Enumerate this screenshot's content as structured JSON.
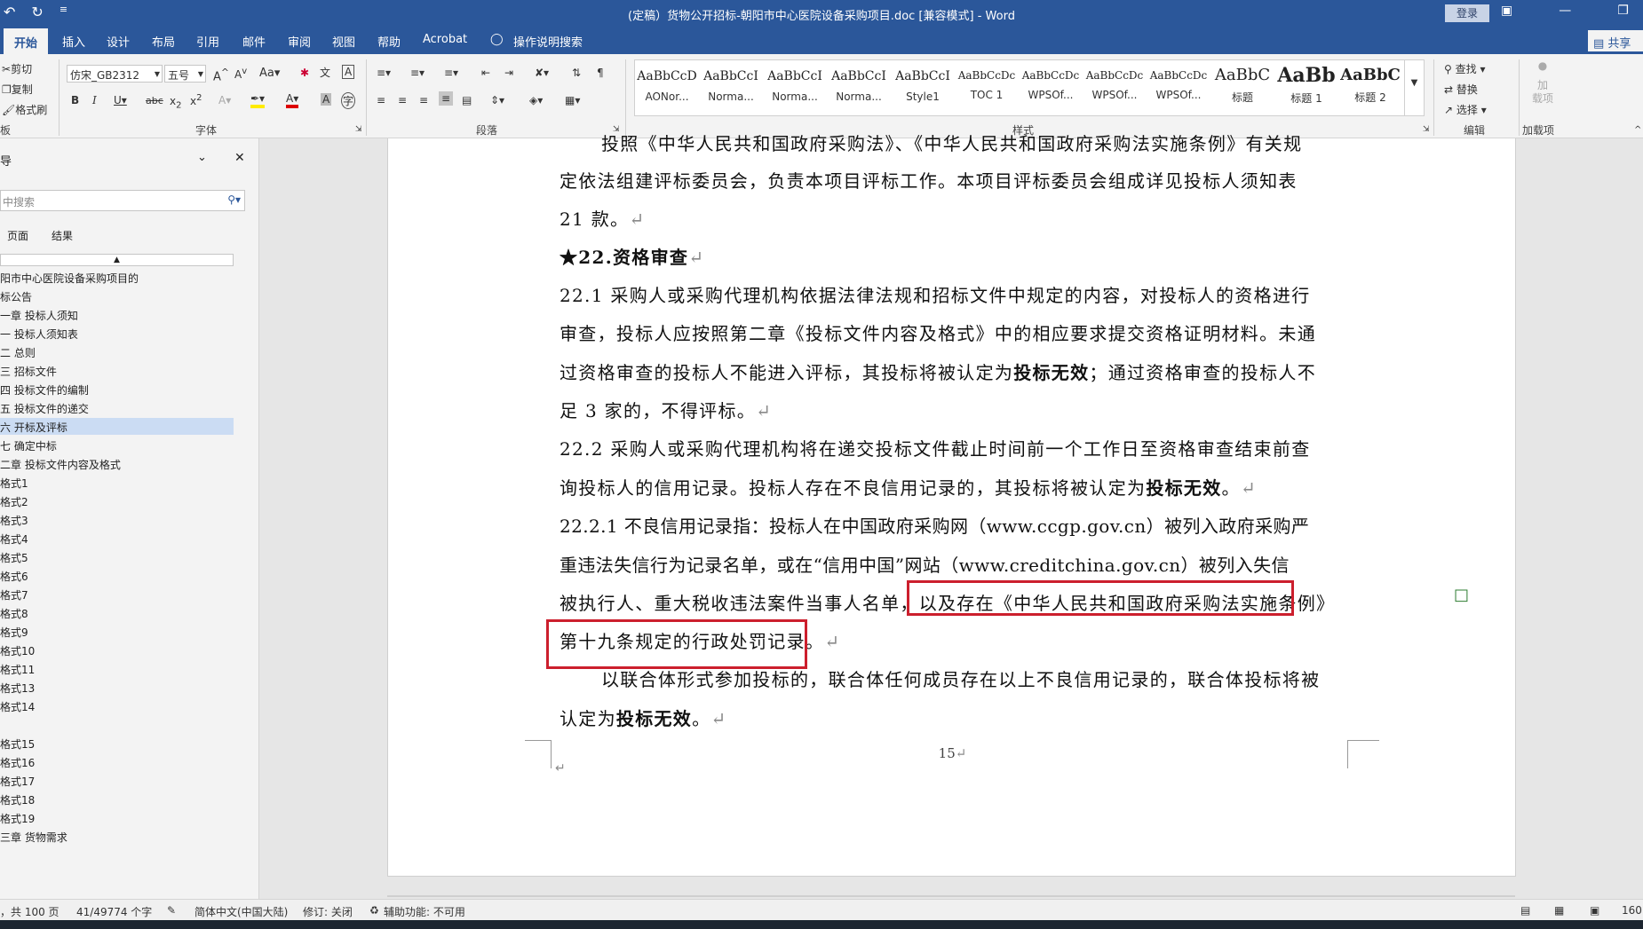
{
  "titlebar": {
    "title": "(定稿）货物公开招标-朝阳市中心医院设备采购项目.doc [兼容模式] - Word",
    "login": "登录",
    "undo_icon": "undo-icon",
    "redo_icon": "redo-icon"
  },
  "tabs": [
    "开始",
    "插入",
    "设计",
    "布局",
    "引用",
    "邮件",
    "审阅",
    "视图",
    "帮助",
    "Acrobat",
    "操作说明搜索"
  ],
  "share": "共享",
  "ribbon": {
    "clipboard": {
      "cut": "剪切",
      "copy": "复制",
      "format_painter": "格式刷",
      "label": "板"
    },
    "font": {
      "name": "仿宋_GB2312",
      "size": "五号",
      "label": "字体"
    },
    "paragraph": {
      "label": "段落"
    },
    "styles": {
      "label": "样式",
      "items": [
        {
          "preview": "AaBbCcD",
          "name": "AONor..."
        },
        {
          "preview": "AaBbCcI",
          "name": "Norma..."
        },
        {
          "preview": "AaBbCcI",
          "name": "Norma..."
        },
        {
          "preview": "AaBbCcI",
          "name": "Norma..."
        },
        {
          "preview": "AaBbCcI",
          "name": "Style1"
        },
        {
          "preview": "AaBbCcDc",
          "name": "TOC 1"
        },
        {
          "preview": "AaBbCcDc",
          "name": "WPSOf..."
        },
        {
          "preview": "AaBbCcDc",
          "name": "WPSOf..."
        },
        {
          "preview": "AaBbCcDc",
          "name": "WPSOf..."
        },
        {
          "preview": "AaBbC",
          "name": "标题"
        },
        {
          "preview": "AaBb",
          "name": "标题 1"
        },
        {
          "preview": "AaBbC",
          "name": "标题 2"
        }
      ]
    },
    "editing": {
      "find": "查找",
      "replace": "替换",
      "select": "选择",
      "label": "编辑"
    },
    "addins": {
      "btn": "加\n载项",
      "label": "加载项"
    }
  },
  "navpane": {
    "title": "导",
    "search_placeholder": "中搜索",
    "tabs": [
      "页面",
      "结果"
    ],
    "items": [
      "阳市中心医院设备采购项目的",
      "标公告",
      "一章 投标人须知",
      "一 投标人须知表",
      "二 总则",
      "三 招标文件",
      "四 投标文件的编制",
      "五 投标文件的递交",
      "六 开标及评标",
      "七 确定中标",
      "二章 投标文件内容及格式",
      "格式1",
      "格式2",
      "格式3",
      "格式4",
      "格式5",
      "格式6",
      "格式7",
      "格式8",
      "格式9",
      "格式10",
      "格式11",
      "格式13",
      "格式14",
      "",
      "格式15",
      "格式16",
      "格式17",
      "格式18",
      "格式19",
      "三章 货物需求"
    ],
    "selected_index": 8
  },
  "document": {
    "lines": [
      "投照《中华人民共和国政府采购法》、《中华人民共和国政府采购法实施条例》有关规",
      "定依法组建评标委员会，负责本项目评标工作。本项目评标委员会组成详见投标人须知表",
      "21 款。",
      "★22.资格审查",
      "22.1 采购人或采购代理机构依据法律法规和招标文件中规定的内容，对投标人的资格进行",
      "审查，投标人应按照第二章《投标文件内容及格式》中的相应要求提交资格证明材料。未通",
      "过资格审查的投标人不能进入评标，其投标将被认定为",
      "投标无效",
      "；通过资格审查的投标人不",
      "足 3 家的，不得评标。",
      "22.2 采购人或采购代理机构将在递交投标文件截止时间前一个工作日至资格审查结束前查",
      "询投标人的信用记录。投标人存在不良信用记录的，其投标将被认定为",
      "投标无效",
      "。",
      "22.2.1 不良信用记录指：投标人在中国政府采购网（www.ccgp.gov.cn）被列入政府采购严",
      "重违法失信行为记录名单，或在“信用中国”网站（www.creditchina.gov.cn）被列入失信",
      "被执行人、重大税收违法案件当事人名单，以及存在《中华人民共和国政府采购法实施条例》",
      "第十九条规定的行政处罚记录。",
      "以联合体形式参加投标的，联合体任何成员存在以上不良信用记录的，联合体投标将被",
      "认定为",
      "投标无效",
      "。"
    ],
    "page_number": "15"
  },
  "statusbar": {
    "pages": "，共 100 页",
    "words": "41/49774 个字",
    "language": "简体中文(中国大陆)",
    "track": "修订: 关闭",
    "accessibility": "辅助功能: 不可用",
    "zoom": "160"
  },
  "colors": {
    "ribbon_blue": "#2b579a",
    "highlight_red": "#cc1f2d",
    "nav_selected": "#cbdcf3"
  }
}
